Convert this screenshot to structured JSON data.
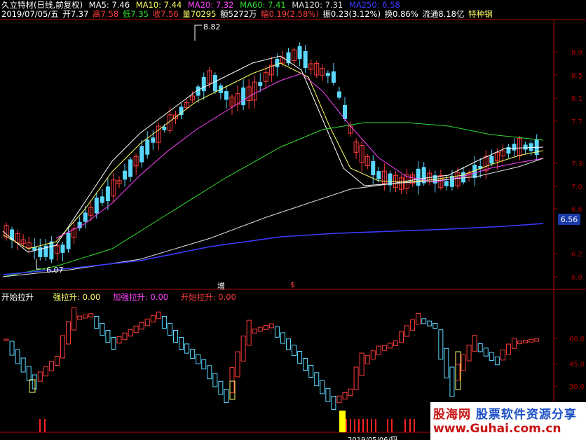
{
  "header": {
    "title": "久立特材(日线,前复权)",
    "ma5": "MA5: 7.46",
    "ma10": "MA10: 7.44",
    "ma20": "MA20: 7.32",
    "ma60": "MA60: 7.41",
    "ma120": "MA120: 7.31",
    "ma250": "MA250: 6.58",
    "date": "2019/07/05/五",
    "open": "开7.37",
    "high": "高7.58",
    "low": "低7.35",
    "close": "收7.56",
    "volume": "量70295",
    "amount": "额5272万",
    "change": "幅0.19(2.58%)",
    "amplitude": "振0.23(3.12%)",
    "turnover": "换0.86%",
    "float": "流通8.18亿",
    "category": "特种钢"
  },
  "price_axis": {
    "ticks": [
      "8.9",
      "8.5",
      "8.1",
      "7.7",
      "7.3",
      "7.0",
      "6.6",
      "6.2",
      "6.0"
    ],
    "current_price": "6.56"
  },
  "annotations": {
    "high_label": "8.82",
    "low_label": "6.07",
    "mark_increase": "增",
    "mark_dollar": "$"
  },
  "indicator": {
    "title": "开始拉升",
    "line1": "强拉升: 0.00",
    "line2": "加强拉升: 0.00",
    "line3": "开始拉升: 0.00",
    "ticks": [
      "60.0",
      "45.0",
      "30.0"
    ],
    "bottom_date": "2019/05/06/四"
  },
  "watermark": {
    "brand": "股海网",
    "slogan": "股票软件资源分享",
    "url": "www.Guhai.com.cn"
  },
  "colors": {
    "up": "#ff3b3b",
    "down": "#5ad7ff",
    "ma5": "#ffffff",
    "ma10": "#ffff66",
    "ma20": "#ff44ff",
    "ma60": "#33dd33",
    "ma120": "#dddddd",
    "ma250": "#3b3bff",
    "axis": "#b00000"
  }
}
